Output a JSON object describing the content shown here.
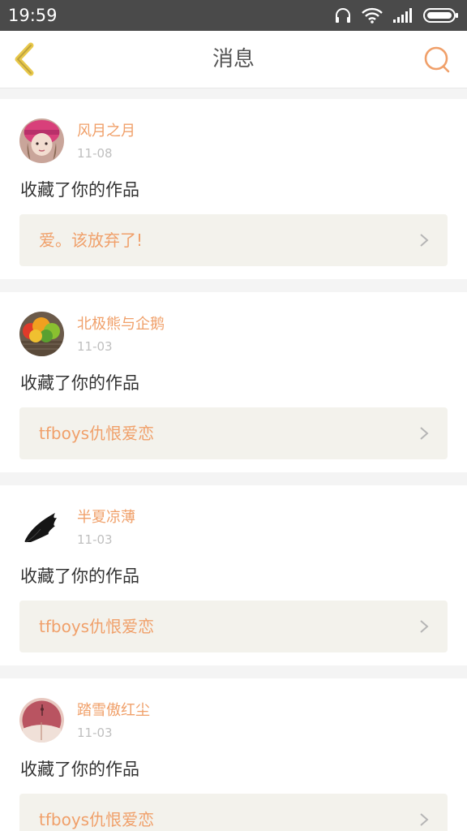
{
  "status_bar": {
    "time": "19:59",
    "icons": [
      "headphones-icon",
      "wifi-icon",
      "signal-icon",
      "battery-icon"
    ]
  },
  "header": {
    "title": "消息",
    "back_icon": "chevron-left-icon",
    "search_icon": "search-icon"
  },
  "colors": {
    "accent": "#f0a06a",
    "back_accent": "#e8c84a",
    "status_bar_bg": "#4a4a4a",
    "card_link_bg": "#f3f2ec"
  },
  "messages": [
    {
      "username": "风月之月",
      "date": "11-08",
      "action": "收藏了你的作品",
      "work_title": "爱。该放弃了!",
      "avatar": "girl-pink-hat-avatar"
    },
    {
      "username": "北极熊与企鹅",
      "date": "11-03",
      "action": "收藏了你的作品",
      "work_title": "tfboys仇恨爱恋",
      "avatar": "colorful-leaves-avatar"
    },
    {
      "username": "半夏凉薄",
      "date": "11-03",
      "action": "收藏了你的作品",
      "work_title": "tfboys仇恨爱恋",
      "avatar": "black-wing-avatar"
    },
    {
      "username": "踏雪傲红尘",
      "date": "11-03",
      "action": "收藏了你的作品",
      "work_title": "tfboys仇恨爱恋",
      "avatar": "red-book-avatar"
    }
  ]
}
